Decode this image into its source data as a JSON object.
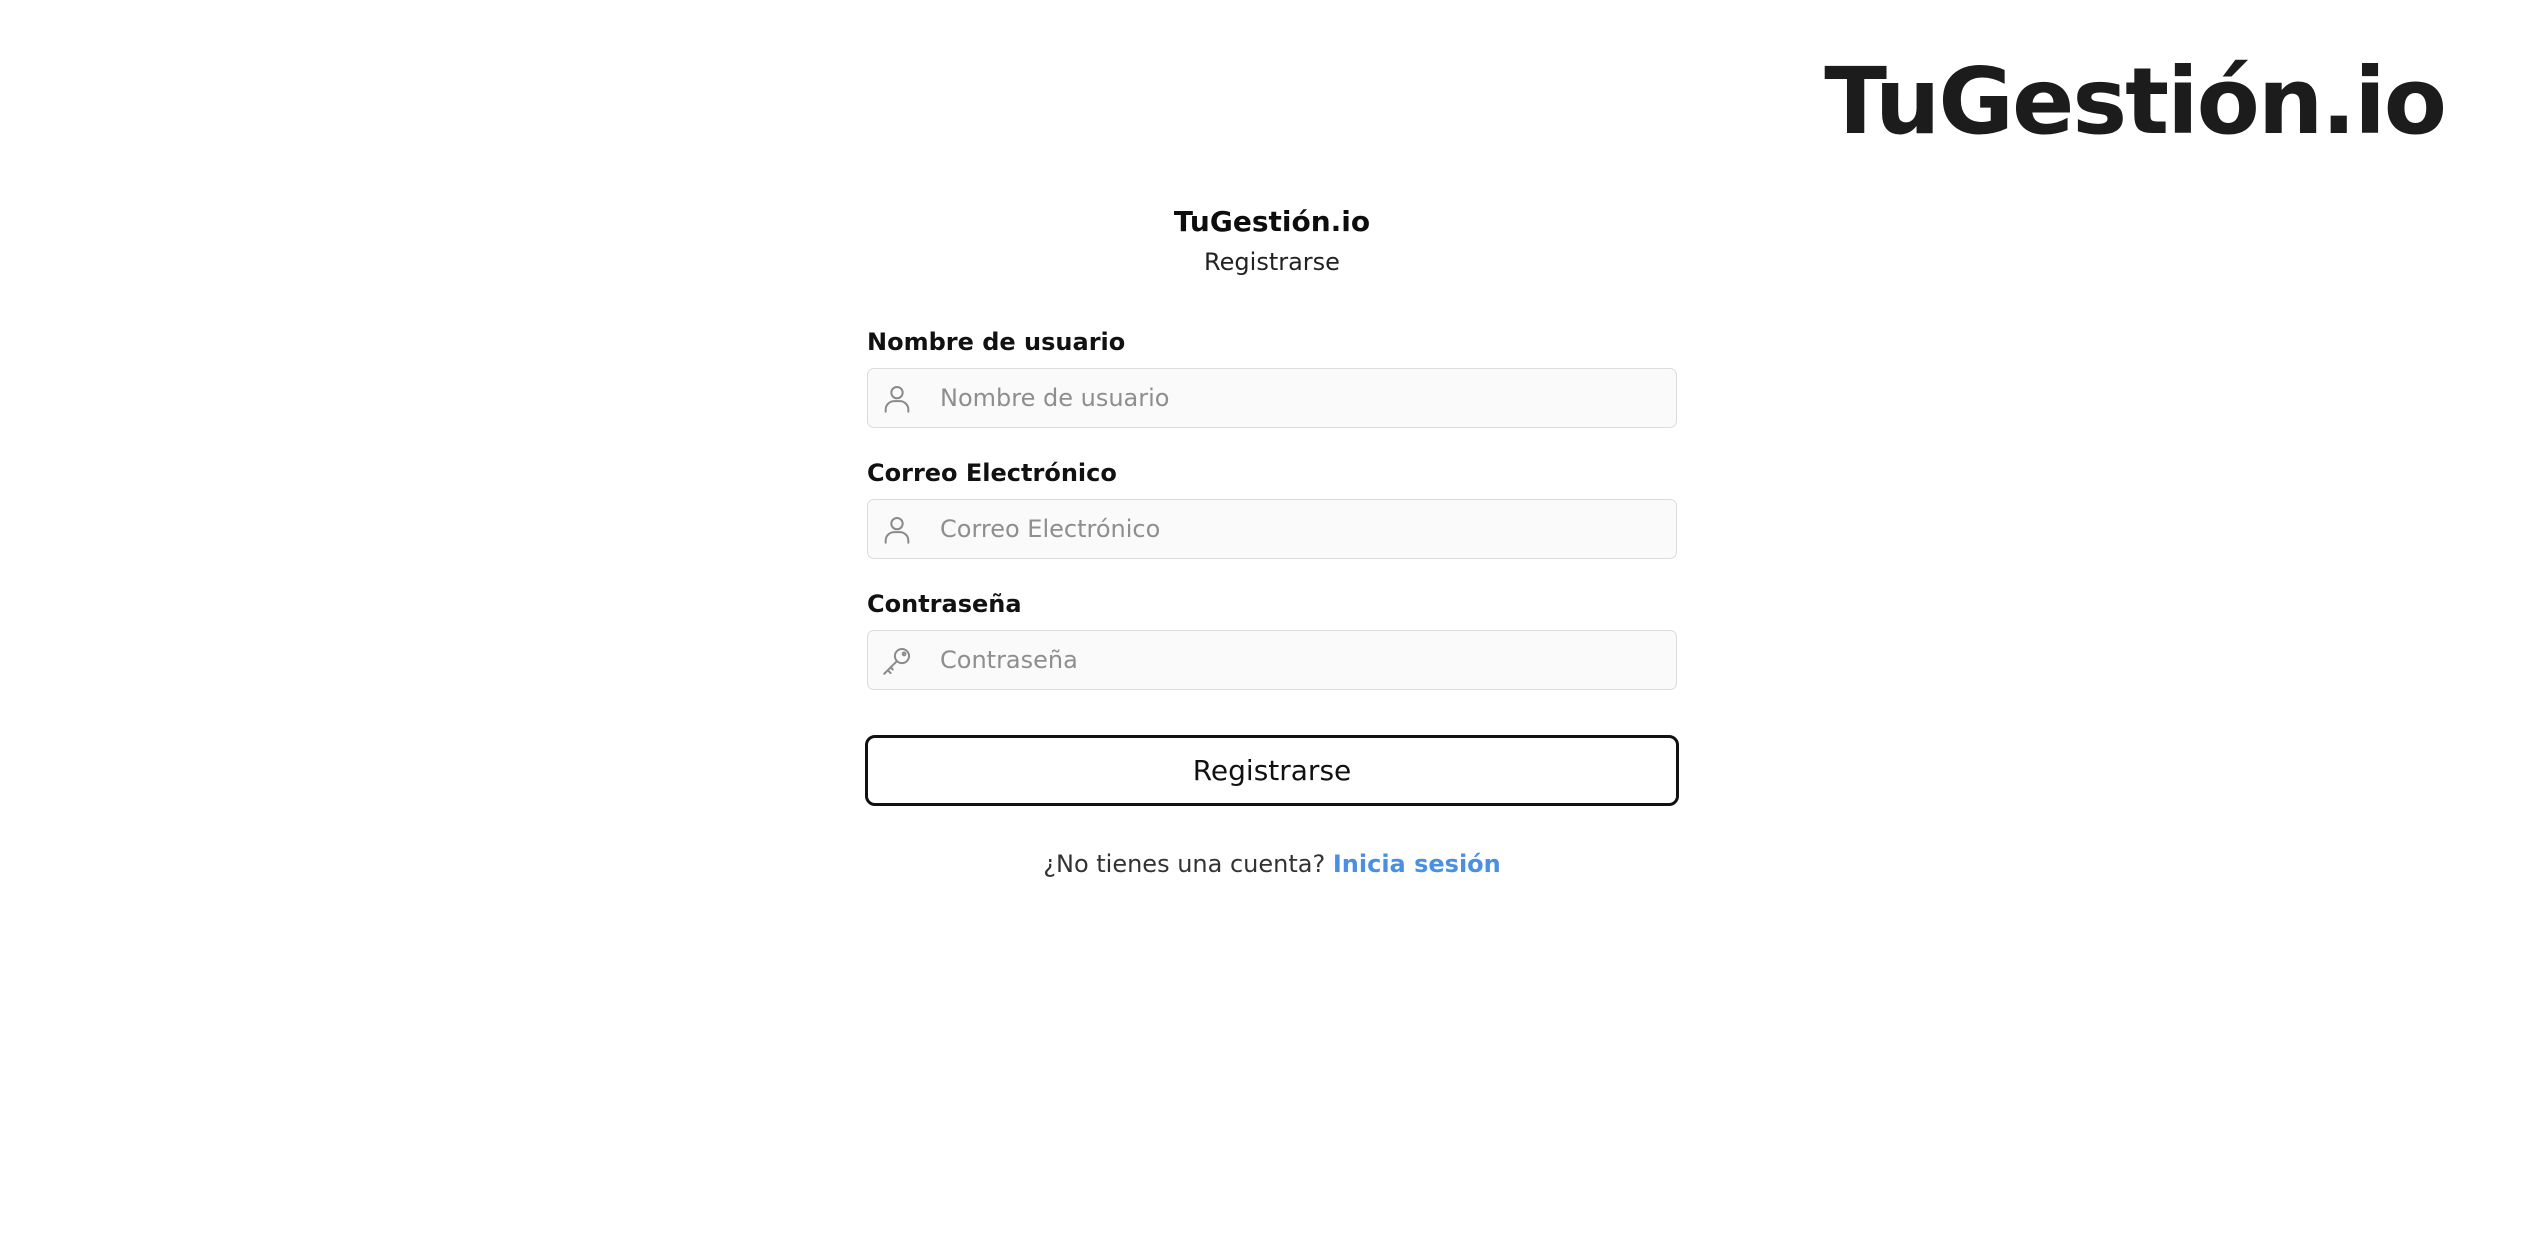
{
  "brand": {
    "logo_text": "TuGestión.io"
  },
  "header": {
    "app_name": "TuGestión.io",
    "subtitle": "Registrarse"
  },
  "form": {
    "username": {
      "label": "Nombre de usuario",
      "placeholder": "Nombre de usuario",
      "value": "",
      "icon": "user-icon"
    },
    "email": {
      "label": "Correo Electrónico",
      "placeholder": "Correo Electrónico",
      "value": "",
      "icon": "user-icon"
    },
    "password": {
      "label": "Contraseña",
      "placeholder": "Contraseña",
      "value": "",
      "icon": "key-icon"
    },
    "submit_label": "Registrarse"
  },
  "footer": {
    "prompt": "¿No tienes una cuenta?",
    "link_label": "Inicia sesión",
    "link_color": "#4a90e2"
  }
}
